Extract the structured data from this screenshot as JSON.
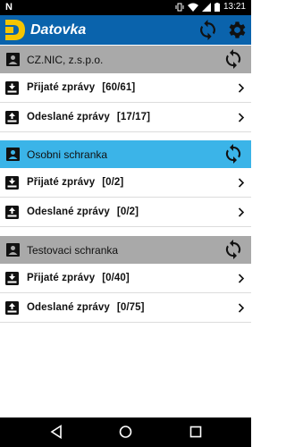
{
  "status_bar": {
    "time": "13:21",
    "notification_icon": "N"
  },
  "app_bar": {
    "title": "Datovka",
    "logo_letter": "D",
    "icons": [
      "sync-all-icon",
      "gear-icon"
    ]
  },
  "colors": {
    "app_bar": "#0a63ac",
    "account_header_default": "#a9a9a9",
    "account_header_selected": "#3bb4e8",
    "logo_yellow": "#f5c500"
  },
  "accounts": [
    {
      "name": "CZ.NIC, z.s.p.o.",
      "selected": false,
      "received_label": "Přijaté zprávy",
      "received_count": "[60/61]",
      "sent_label": "Odeslané zprávy",
      "sent_count": "[17/17]"
    },
    {
      "name": "Osobni schranka",
      "selected": true,
      "received_label": "Přijaté zprávy",
      "received_count": "[0/2]",
      "sent_label": "Odeslané zprávy",
      "sent_count": "[0/2]"
    },
    {
      "name": "Testovaci schranka",
      "selected": false,
      "received_label": "Přijaté zprávy",
      "received_count": "[0/40]",
      "sent_label": "Odeslané zprávy",
      "sent_count": "[0/75]"
    }
  ],
  "nav_bar": {
    "buttons": [
      "back-icon",
      "home-icon",
      "recents-icon"
    ]
  }
}
